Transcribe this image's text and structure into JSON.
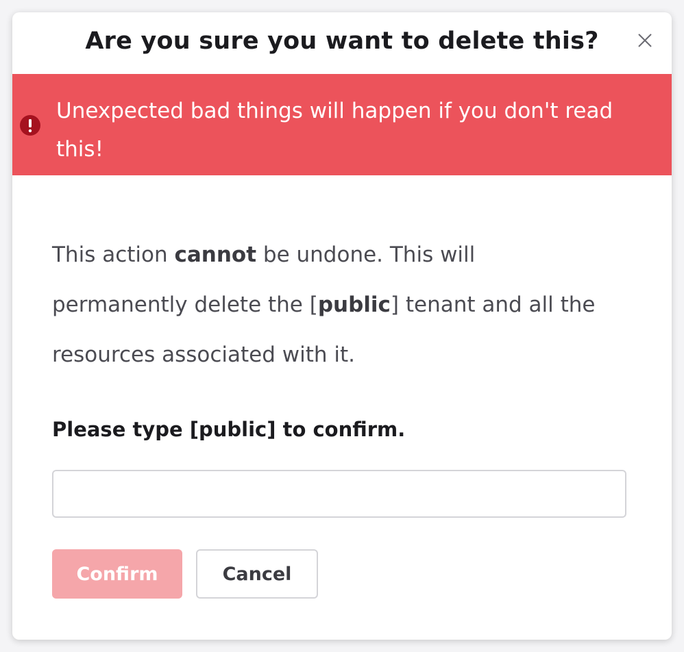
{
  "dialog": {
    "title": "Are you sure you want to delete this?",
    "close_icon": "close-icon"
  },
  "alert": {
    "icon": "exclamation-circle-icon",
    "message": "Unexpected bad things will happen if you don't read this!",
    "background_color": "#ec535b"
  },
  "body": {
    "part1": "This action ",
    "bold1": "cannot",
    "part2": " be undone. This will permanently delete the [",
    "bold2": "public",
    "part3": "] tenant and all the resources associated with it."
  },
  "confirm": {
    "label": "Please type [public] to confirm.",
    "input_value": "",
    "input_placeholder": ""
  },
  "buttons": {
    "confirm_label": "Confirm",
    "cancel_label": "Cancel",
    "confirm_color": "#f5a6aa"
  }
}
